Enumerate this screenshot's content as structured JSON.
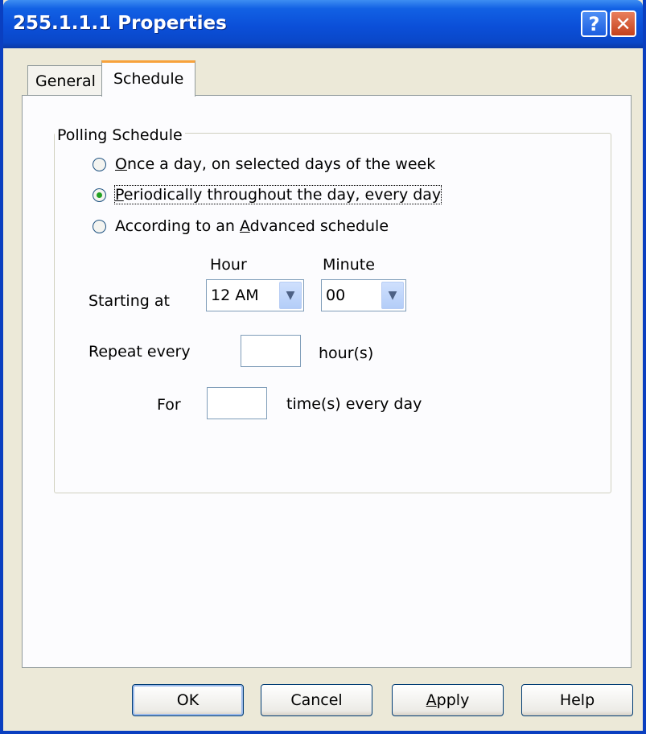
{
  "window": {
    "title": "255.1.1.1 Properties",
    "help_glyph": "?",
    "close_glyph": "✕"
  },
  "tabs": [
    {
      "label": "General",
      "selected": false
    },
    {
      "label": "Schedule",
      "selected": true
    }
  ],
  "polling_schedule": {
    "legend": "Polling Schedule",
    "options": [
      {
        "pre": "",
        "accel": "O",
        "post": "nce a day, on selected days of the week",
        "checked": false
      },
      {
        "pre": "",
        "accel": "P",
        "post": "eriodically throughout the day, every day",
        "checked": true
      },
      {
        "pre": "According to an ",
        "accel": "A",
        "post": "dvanced schedule",
        "checked": false
      }
    ],
    "hour_header": "Hour",
    "minute_header": "Minute",
    "starting_at_label": "Starting at",
    "hour_value": "12 AM",
    "minute_value": "00",
    "repeat_label": "Repeat every",
    "repeat_value": "",
    "repeat_unit": "hour(s)",
    "for_label": "For",
    "for_value": "",
    "for_unit": "time(s) every day"
  },
  "buttons": {
    "ok": "OK",
    "cancel": "Cancel",
    "apply_accel": "A",
    "apply_rest": "pply",
    "help": "Help"
  },
  "icons": {
    "dropdown": "▼"
  }
}
